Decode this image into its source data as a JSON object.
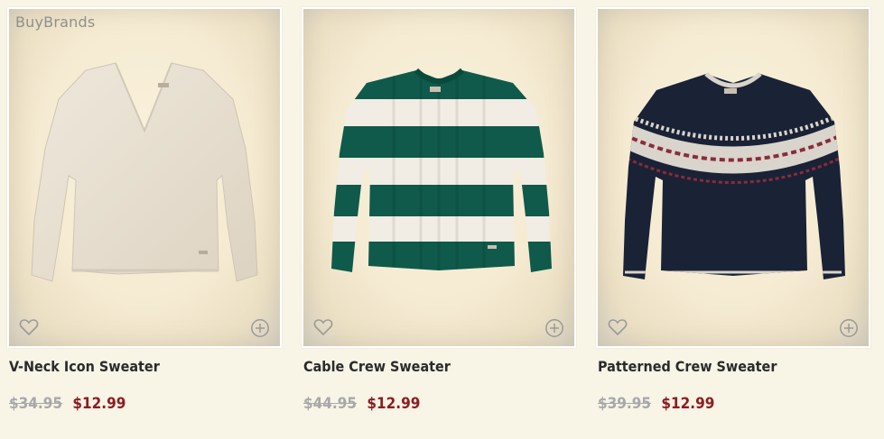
{
  "watermark": "BuyBrands",
  "products": [
    {
      "name": "V-Neck Icon Sweater",
      "old_price": "$34.95",
      "sale_price": "$12.99",
      "color": "#e8e0d2"
    },
    {
      "name": "Cable Crew Sweater",
      "old_price": "$44.95",
      "sale_price": "$12.99",
      "color": "#0f5a4a"
    },
    {
      "name": "Patterned Crew Sweater",
      "old_price": "$39.95",
      "sale_price": "$12.99",
      "color": "#1a2236"
    }
  ],
  "icons": {
    "wishlist": "heart-outline-icon",
    "add": "plus-circle-icon"
  },
  "colors": {
    "sale": "#8a1e22",
    "strike": "#a8a8a8",
    "name": "#2b2b2b",
    "background": "#f8f4e6"
  }
}
